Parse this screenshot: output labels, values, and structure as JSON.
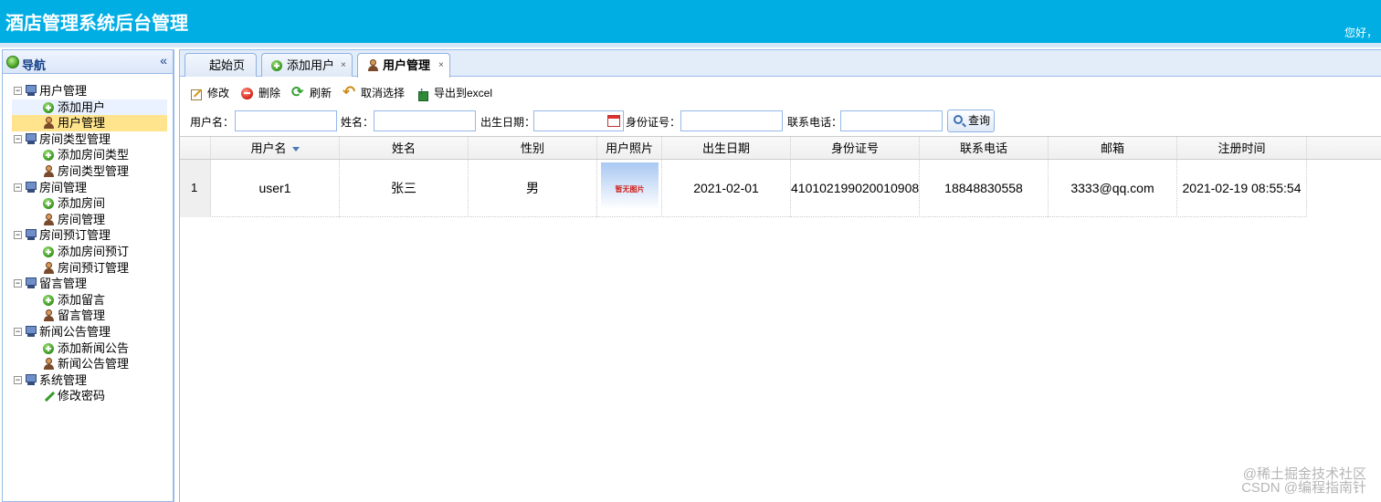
{
  "header": {
    "title": "酒店管理系统后台管理",
    "greeting": "您好，",
    "bg_color": "#00aee4"
  },
  "nav": {
    "title": "导航",
    "collapse_glyph": "«",
    "groups": [
      {
        "label": "用户管理",
        "children": [
          {
            "label": "添加用户",
            "icon": "add-icon",
            "state": "hover"
          },
          {
            "label": "用户管理",
            "icon": "user-icon",
            "state": "selected"
          }
        ]
      },
      {
        "label": "房间类型管理",
        "children": [
          {
            "label": "添加房间类型",
            "icon": "add-icon"
          },
          {
            "label": "房间类型管理",
            "icon": "user-icon"
          }
        ]
      },
      {
        "label": "房间管理",
        "children": [
          {
            "label": "添加房间",
            "icon": "add-icon"
          },
          {
            "label": "房间管理",
            "icon": "user-icon"
          }
        ]
      },
      {
        "label": "房间预订管理",
        "children": [
          {
            "label": "添加房间预订",
            "icon": "add-icon"
          },
          {
            "label": "房间预订管理",
            "icon": "user-icon"
          }
        ]
      },
      {
        "label": "留言管理",
        "children": [
          {
            "label": "添加留言",
            "icon": "add-icon"
          },
          {
            "label": "留言管理",
            "icon": "user-icon"
          }
        ]
      },
      {
        "label": "新闻公告管理",
        "children": [
          {
            "label": "添加新闻公告",
            "icon": "add-icon"
          },
          {
            "label": "新闻公告管理",
            "icon": "user-icon"
          }
        ]
      },
      {
        "label": "系统管理",
        "children": [
          {
            "label": "修改密码",
            "icon": "pencil-icon"
          }
        ]
      }
    ]
  },
  "tabs": [
    {
      "label": "起始页",
      "closable": false,
      "active": false
    },
    {
      "label": "添加用户",
      "closable": true,
      "active": false
    },
    {
      "label": "用户管理",
      "closable": true,
      "active": true
    }
  ],
  "tab_close_glyph": "×",
  "toolbar": {
    "edit": "修改",
    "delete": "删除",
    "refresh": "刷新",
    "cancel_select": "取消选择",
    "export": "导出到excel"
  },
  "search": {
    "username_label": "用户名：",
    "name_label": "姓名：",
    "birthday_label": "出生日期：",
    "idcard_label": "身份证号：",
    "phone_label": "联系电话：",
    "query_button": "查询"
  },
  "grid": {
    "columns": [
      "用户名",
      "姓名",
      "性别",
      "用户照片",
      "出生日期",
      "身份证号",
      "联系电话",
      "邮箱",
      "注册时间"
    ],
    "rows": [
      {
        "num": "1",
        "username": "user1",
        "name": "张三",
        "gender": "男",
        "photo_text": "暂无图片",
        "birthday": "2021-02-01",
        "idcard": "410102199020010908",
        "phone": "18848830558",
        "email": "3333@qq.com",
        "register_time": "2021-02-19 08:55:54"
      }
    ]
  },
  "watermark": {
    "line1": "@稀土掘金技术社区",
    "line2": "CSDN @编程指南针"
  }
}
